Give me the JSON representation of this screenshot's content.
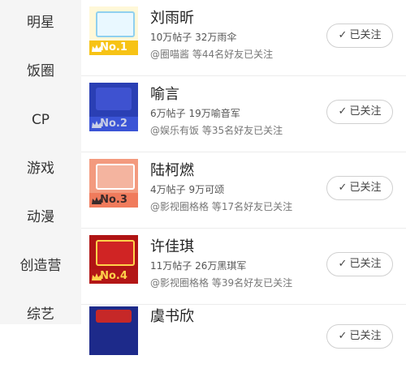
{
  "sidebar": {
    "items": [
      {
        "label": "明星"
      },
      {
        "label": "饭圈"
      },
      {
        "label": "CP"
      },
      {
        "label": "游戏"
      },
      {
        "label": "动漫"
      },
      {
        "label": "创造营"
      },
      {
        "label": "综艺"
      }
    ]
  },
  "list": {
    "items": [
      {
        "name": "刘雨昕",
        "stats": "10万帖子 32万雨伞",
        "friends": "@圈喵酱 等44名好友已关注",
        "rank": "No.1",
        "follow_label": "已关注",
        "thumb_colors": {
          "bg": "#fff8d8",
          "art": "#e9f8ff",
          "rank_bg": "#f7c315",
          "rank_fg": "#ffffff"
        }
      },
      {
        "name": "喻言",
        "stats": "6万帖子 19万喻音军",
        "friends": "@娱乐有饭 等35名好友已关注",
        "rank": "No.2",
        "follow_label": "已关注",
        "thumb_colors": {
          "bg": "#2a3fb4",
          "art": "#3e52d0",
          "rank_bg": "#3b54d6",
          "rank_fg": "#c9cfe6"
        }
      },
      {
        "name": "陆柯燃",
        "stats": "4万帖子 9万可颂",
        "friends": "@影视圈格格 等17名好友已关注",
        "rank": "No.3",
        "follow_label": "已关注",
        "thumb_colors": {
          "bg": "#f39a7e",
          "art": "#f4b49f",
          "rank_bg": "#f07b5c",
          "rank_fg": "#3a2a2a"
        }
      },
      {
        "name": "许佳琪",
        "stats": "11万帖子 26万黑琪军",
        "friends": "@影视圈格格 等39名好友已关注",
        "rank": "No.4",
        "follow_label": "已关注",
        "thumb_colors": {
          "bg": "#b01414",
          "art": "#d02424",
          "rank_bg": "#b31616",
          "rank_fg": "#ffd24a"
        }
      },
      {
        "name": "虞书欣",
        "stats": "",
        "friends": "",
        "rank": "",
        "follow_label": "已关注",
        "thumb_colors": {
          "bg": "#1d2a8a",
          "art": "#c62828",
          "rank_bg": "#1d2a8a",
          "rank_fg": "#ffffff"
        }
      }
    ]
  },
  "colors": {
    "sidebar_bg": "#f5f5f5",
    "divider": "#ececec",
    "button_border": "#d0d0d0"
  },
  "icons": {
    "follow": "check-icon",
    "rank": "crown-icon"
  }
}
